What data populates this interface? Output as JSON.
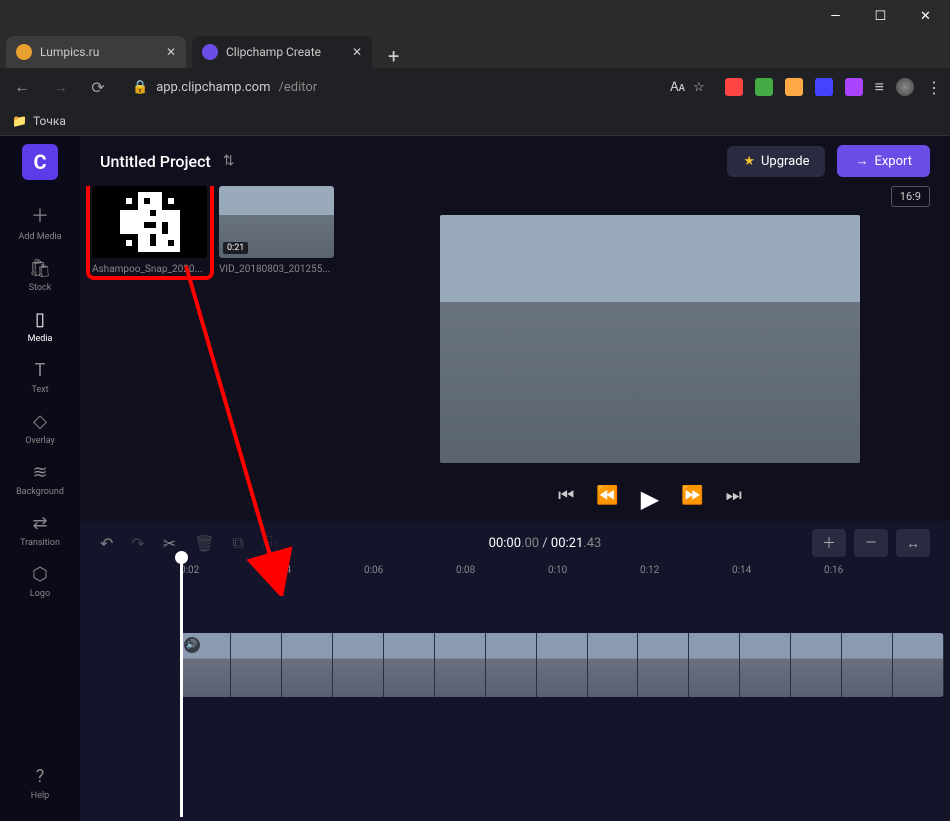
{
  "window": {
    "min": "—",
    "max": "☐",
    "close": "✕"
  },
  "browser": {
    "tabs": [
      {
        "title": "Lumpics.ru",
        "favicon": "#e8a030"
      },
      {
        "title": "Clipchamp Create",
        "favicon": "#6b4de8"
      }
    ],
    "url_host": "app.clipchamp.com",
    "url_path": "/editor",
    "bookmark_folder": "Точка"
  },
  "app": {
    "logo": "C",
    "title": "Untitled Project",
    "upgrade_label": "Upgrade",
    "export_label": "Export",
    "aspect_ratio": "16:9",
    "sidebar": [
      {
        "icon": "＋",
        "label": "Add Media"
      },
      {
        "icon": "🛍",
        "label": "Stock"
      },
      {
        "icon": "▯",
        "label": "Media"
      },
      {
        "icon": "T",
        "label": "Text"
      },
      {
        "icon": "◇",
        "label": "Overlay"
      },
      {
        "icon": "≋",
        "label": "Background"
      },
      {
        "icon": "⇄",
        "label": "Transition"
      },
      {
        "icon": "⬡",
        "label": "Logo"
      }
    ],
    "help_label": "Help",
    "media": [
      {
        "name": "Ashampoo_Snap_2020...",
        "duration": ""
      },
      {
        "name": "VID_20180803_201255...",
        "duration": "0:21"
      }
    ],
    "timecode": {
      "current": "00:00",
      "current_ms": ".00",
      "sep": " / ",
      "total": "00:21",
      "total_ms": ".43"
    },
    "ruler": [
      "0:02",
      "0:04",
      "0:06",
      "0:08",
      "0:10",
      "0:12",
      "0:14",
      "0:16"
    ],
    "controls": {
      "start": "⏮",
      "rw": "⏪",
      "play": "▶",
      "ff": "⏩",
      "end": "⏭"
    },
    "tools": {
      "undo": "↶",
      "redo": "↷",
      "cut": "✂",
      "del": "🗑",
      "copy": "⧉",
      "dup": "⿻"
    },
    "zoom": {
      "plus": "＋",
      "minus": "—",
      "fit": "↔"
    }
  }
}
